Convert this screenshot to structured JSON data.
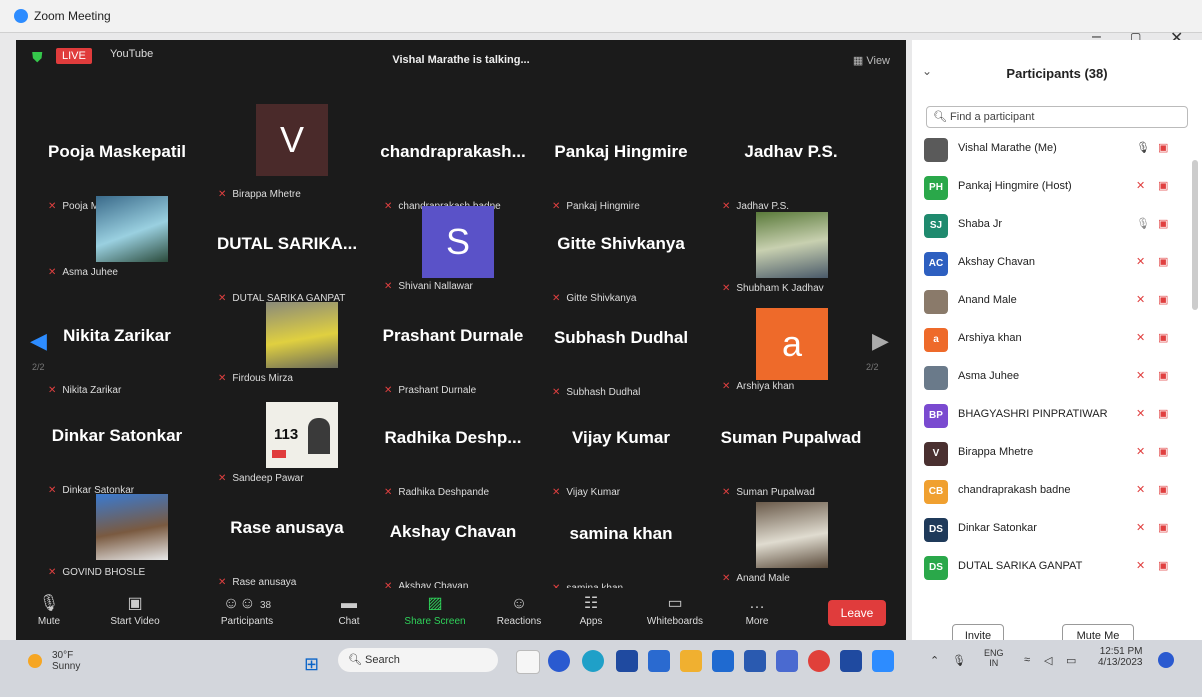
{
  "window": {
    "title": "Zoom Meeting",
    "ctl_min": "–",
    "ctl_restore": "▢",
    "ctl_close": "✕"
  },
  "topbar": {
    "live": "LIVE",
    "youtube": "YouTube",
    "talking": "Vishal Marathe is talking...",
    "view": "▦ View"
  },
  "tiles": [
    {
      "big": "Pooja Maskepatil",
      "label": "Pooja Maskepatil"
    },
    {
      "big": "",
      "label": "Birappa Mhetre",
      "avatar": "V"
    },
    {
      "big": "chandraprakash...",
      "label": "chandraprakash badne"
    },
    {
      "big": "Pankaj Hingmire",
      "label": "Pankaj Hingmire"
    },
    {
      "big": "Jadhav P.S.",
      "label": "Jadhav P.S."
    },
    {
      "big": "",
      "label": "Asma Juhee"
    },
    {
      "big": "DUTAL SARIKA...",
      "label": "DUTAL SARIKA GANPAT"
    },
    {
      "big": "",
      "label": "Shivani Nallawar",
      "avatar": "S"
    },
    {
      "big": "Gitte Shivkanya",
      "label": "Gitte Shivkanya"
    },
    {
      "big": "",
      "label": "Shubham K Jadhav"
    },
    {
      "big": "Nikita Zarikar",
      "label": "Nikita Zarikar"
    },
    {
      "big": "",
      "label": "Firdous Mirza"
    },
    {
      "big": "Prashant Durnale",
      "label": "Prashant Durnale"
    },
    {
      "big": "Subhash Dudhal",
      "label": "Subhash Dudhal"
    },
    {
      "big": "",
      "label": "Arshiya khan",
      "avatar": "a"
    },
    {
      "big": "Dinkar Satonkar",
      "label": "Dinkar Satonkar"
    },
    {
      "big": "",
      "label": "Sandeep Pawar",
      "badge": "113"
    },
    {
      "big": "Radhika Deshp...",
      "label": "Radhika Deshpande"
    },
    {
      "big": "Vijay Kumar",
      "label": "Vijay Kumar"
    },
    {
      "big": "Suman Pupalwad",
      "label": "Suman Pupalwad"
    },
    {
      "big": "",
      "label": "GOVIND BHOSLE"
    },
    {
      "big": "Rase anusaya",
      "label": "Rase anusaya"
    },
    {
      "big": "Akshay Chavan",
      "label": "Akshay Chavan"
    },
    {
      "big": "samina khan",
      "label": "samina khan"
    },
    {
      "big": "",
      "label": "Anand Male"
    }
  ],
  "pager": {
    "left": "2/2",
    "right": "2/2"
  },
  "toolbar": {
    "mute": "Mute",
    "start_video": "Start Video",
    "participants": "Participants",
    "participants_count": "38",
    "chat": "Chat",
    "share_screen": "Share Screen",
    "reactions": "Reactions",
    "apps": "Apps",
    "whiteboards": "Whiteboards",
    "more": "More",
    "leave": "Leave"
  },
  "panel": {
    "title": "Participants (38)",
    "search_placeholder": "Find a participant",
    "participants": [
      {
        "initials": "",
        "name": "Vishal Marathe (Me)",
        "color": "#5a5a5a"
      },
      {
        "initials": "PH",
        "name": "Pankaj Hingmire (Host)",
        "color": "#2aa84a"
      },
      {
        "initials": "SJ",
        "name": "Shaba Jr",
        "color": "#1f8a6e"
      },
      {
        "initials": "AC",
        "name": "Akshay Chavan",
        "color": "#2d5fc0"
      },
      {
        "initials": "",
        "name": "Anand Male",
        "color": "#8a7a6a"
      },
      {
        "initials": "a",
        "name": "Arshiya khan",
        "color": "#ee6a2a"
      },
      {
        "initials": "",
        "name": "Asma Juhee",
        "color": "#6a7a8a"
      },
      {
        "initials": "BP",
        "name": "BHAGYASHRI PINPRATIWAR",
        "color": "#7a4ad0"
      },
      {
        "initials": "V",
        "name": "Birappa Mhetre",
        "color": "#4a3030"
      },
      {
        "initials": "CB",
        "name": "chandraprakash badne",
        "color": "#f0a030"
      },
      {
        "initials": "DS",
        "name": "Dinkar Satonkar",
        "color": "#1f3a5a"
      },
      {
        "initials": "DS",
        "name": "DUTAL SARIKA GANPAT",
        "color": "#2aa84a"
      }
    ],
    "invite": "Invite",
    "mute_me": "Mute Me"
  },
  "taskbar": {
    "weather_temp": "30°F",
    "weather_desc": "Sunny",
    "search": "Search",
    "lang_top": "ENG",
    "lang_bottom": "IN",
    "time": "12:51 PM",
    "date": "4/13/2023"
  },
  "colors": {
    "accent": "#2d8cff",
    "leave": "#e03c3c",
    "meeting_bg": "#1b1b1b",
    "live": "#e03c3c"
  }
}
